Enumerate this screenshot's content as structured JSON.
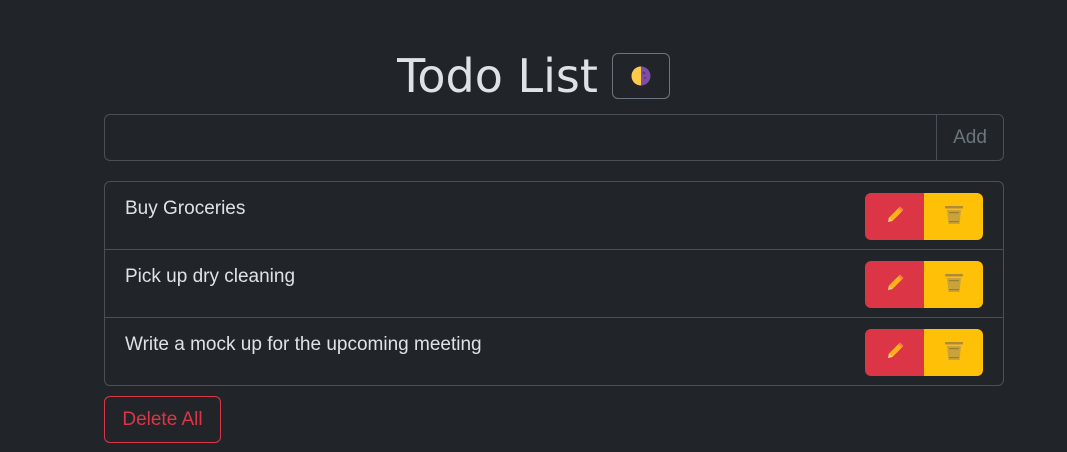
{
  "header": {
    "title": "Todo List",
    "theme_toggle_icon": "half-moon-icon"
  },
  "form": {
    "input_value": "",
    "input_placeholder": "",
    "add_label": "Add"
  },
  "todos": [
    {
      "text": "Buy Groceries",
      "edit_icon": "pencil-icon",
      "delete_icon": "trash-icon"
    },
    {
      "text": "Pick up dry cleaning",
      "edit_icon": "pencil-icon",
      "delete_icon": "trash-icon"
    },
    {
      "text": "Write a mock up for the upcoming meeting",
      "edit_icon": "pencil-icon",
      "delete_icon": "trash-icon"
    }
  ],
  "footer": {
    "delete_all_label": "Delete All"
  },
  "colors": {
    "background": "#212529",
    "text": "#dee2e6",
    "border": "#495057",
    "danger": "#dc3545",
    "warning": "#ffc107",
    "muted": "#6c757d"
  }
}
